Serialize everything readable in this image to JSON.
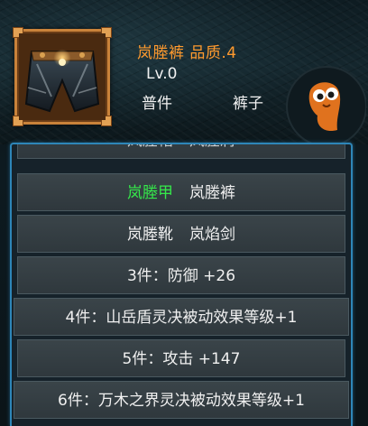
{
  "header": {
    "item_name": "岚塍裤 品质.4",
    "level": "Lv.0",
    "type": "普件",
    "slot": "裤子",
    "icon": "pants-armor-icon",
    "name_color": "#ff9a2e"
  },
  "set": {
    "pieces": [
      [
        "岚塍帽",
        "岚塍肩"
      ],
      [
        "岚塍甲",
        "岚塍裤"
      ],
      [
        "岚塍靴",
        "岚焰剑"
      ]
    ],
    "equipped_color": "#35e84a",
    "bonuses": [
      "3件：防御 +26",
      "4件：山岳盾灵决被动效果等级+1",
      "5件：攻击 +147",
      "6件：万木之界灵决被动效果等级+1"
    ]
  }
}
